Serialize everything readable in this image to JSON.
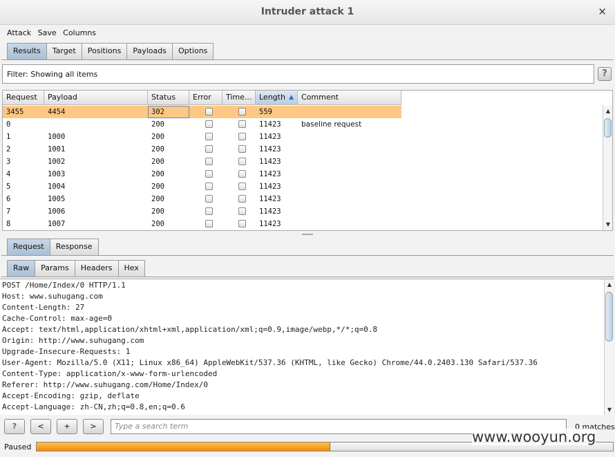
{
  "window": {
    "title": "Intruder attack 1"
  },
  "menu": [
    "Attack",
    "Save",
    "Columns"
  ],
  "main_tabs": [
    {
      "label": "Results",
      "active": true
    },
    {
      "label": "Target"
    },
    {
      "label": "Positions"
    },
    {
      "label": "Payloads"
    },
    {
      "label": "Options"
    }
  ],
  "filter": {
    "text": "Filter: Showing all items",
    "help": "?"
  },
  "table": {
    "columns": [
      "Request",
      "Payload",
      "Status",
      "Error",
      "Time...",
      "Length",
      "Comment"
    ],
    "sort_indicator": "▲",
    "rows": [
      {
        "request": "3455",
        "payload": "4454",
        "status": "302",
        "length": "559",
        "comment": "",
        "selected": true
      },
      {
        "request": "0",
        "payload": "",
        "status": "200",
        "length": "11423",
        "comment": "baseline request"
      },
      {
        "request": "1",
        "payload": "1000",
        "status": "200",
        "length": "11423",
        "comment": ""
      },
      {
        "request": "2",
        "payload": "1001",
        "status": "200",
        "length": "11423",
        "comment": ""
      },
      {
        "request": "3",
        "payload": "1002",
        "status": "200",
        "length": "11423",
        "comment": ""
      },
      {
        "request": "4",
        "payload": "1003",
        "status": "200",
        "length": "11423",
        "comment": ""
      },
      {
        "request": "5",
        "payload": "1004",
        "status": "200",
        "length": "11423",
        "comment": ""
      },
      {
        "request": "6",
        "payload": "1005",
        "status": "200",
        "length": "11423",
        "comment": ""
      },
      {
        "request": "7",
        "payload": "1006",
        "status": "200",
        "length": "11423",
        "comment": ""
      },
      {
        "request": "8",
        "payload": "1007",
        "status": "200",
        "length": "11423",
        "comment": ""
      }
    ]
  },
  "detail_tabs": [
    {
      "label": "Request",
      "active": true
    },
    {
      "label": "Response"
    }
  ],
  "view_tabs": [
    {
      "label": "Raw",
      "active": true
    },
    {
      "label": "Params"
    },
    {
      "label": "Headers"
    },
    {
      "label": "Hex"
    }
  ],
  "raw_lines": [
    "POST /Home/Index/0 HTTP/1.1",
    "Host: www.suhugang.com",
    "Content-Length: 27",
    "Cache-Control: max-age=0",
    "Accept: text/html,application/xhtml+xml,application/xml;q=0.9,image/webp,*/*;q=0.8",
    "Origin: http://www.suhugang.com",
    "Upgrade-Insecure-Requests: 1",
    "User-Agent: Mozilla/5.0 (X11; Linux x86_64) AppleWebKit/537.36 (KHTML, like Gecko) Chrome/44.0.2403.130 Safari/537.36",
    "Content-Type: application/x-www-form-urlencoded",
    "Referer: http://www.suhugang.com/Home/Index/0",
    "Accept-Encoding: gzip, deflate",
    "Accept-Language: zh-CN,zh;q=0.8,en;q=0.6"
  ],
  "search": {
    "help": "?",
    "prev": "<",
    "add": "+",
    "next": ">",
    "placeholder": "Type a search term",
    "matches": "0 matches"
  },
  "status": {
    "label": "Paused",
    "progress": 0.51
  },
  "watermark": "www.wooyun.org",
  "colors": {
    "selected_row": "#ffc784",
    "progress": "#f5a623",
    "active_tab": "#b4c8dc"
  }
}
